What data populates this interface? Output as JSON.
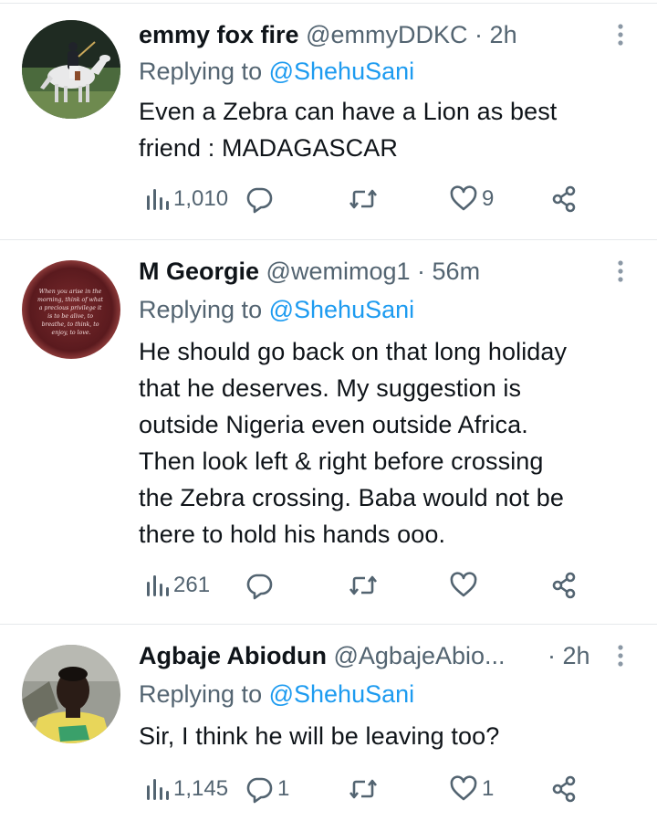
{
  "tweets": [
    {
      "name": "emmy fox fire",
      "handle": "@emmyDDKC",
      "separator": "·",
      "time": "2h",
      "replying_prefix": "Replying to",
      "replying_handle": "@ShehuSani",
      "lines": [
        "Even a Zebra can have a Lion as best",
        "friend : MADAGASCAR"
      ],
      "views": "1,010",
      "replies": "",
      "likes": "9",
      "avatar_icon": "horse-rider-photo"
    },
    {
      "name": "M Georgie",
      "handle": "@wemimog1",
      "separator": "·",
      "time": "56m",
      "replying_prefix": "Replying to",
      "replying_handle": "@ShehuSani",
      "lines": [
        "He should go back on that long holiday",
        "that he deserves. My suggestion is",
        "outside Nigeria even outside Africa.",
        "Then look left & right before crossing",
        "the Zebra  crossing. Baba would not be",
        "there to hold his hands ooo."
      ],
      "views": "261",
      "replies": "",
      "likes": "",
      "avatar_icon": "quote-photo",
      "avatar_text": [
        "When you arise in the",
        "morning, think of what",
        "a precious privilege it",
        "is to be alive, to",
        "breathe, to think, to",
        "enjoy, to love."
      ]
    },
    {
      "name": "Agbaje Abiodun",
      "handle": "@AgbajeAbio...",
      "separator": "·",
      "time": "2h",
      "replying_prefix": "Replying to",
      "replying_handle": "@ShehuSani",
      "lines": [
        "Sir, I think he will be leaving too?"
      ],
      "views": "1,145",
      "replies": "1",
      "likes": "1",
      "avatar_icon": "person-photo"
    }
  ],
  "colors": {
    "text": "#0f1419",
    "secondary": "#536471",
    "link": "#1d9bf0",
    "divider": "#e6e9eb"
  },
  "icons": [
    "views-icon",
    "reply-icon",
    "retweet-icon",
    "like-icon",
    "share-icon",
    "more-icon"
  ]
}
